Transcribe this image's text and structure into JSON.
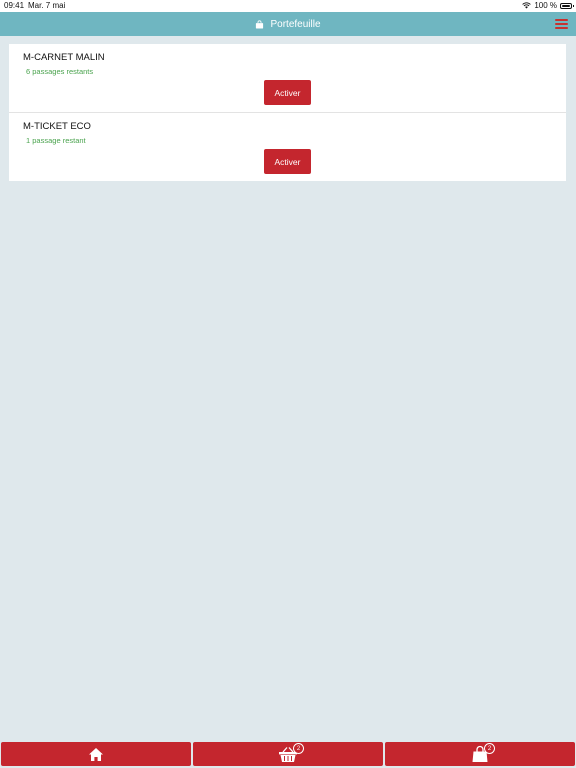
{
  "status_bar": {
    "time": "09:41",
    "date": "Mar. 7 mai",
    "battery": "100 %"
  },
  "header": {
    "title": "Portefeuille",
    "icon": "shopping-bag-icon",
    "menu_icon": "hamburger-menu-icon",
    "background": "#6fb6c1"
  },
  "tickets": [
    {
      "name": "M-CARNET MALIN",
      "remaining": "6 passages restants",
      "button": "Activer"
    },
    {
      "name": "M-TICKET ECO",
      "remaining": "1 passage restant",
      "button": "Activer"
    }
  ],
  "bottom_nav": {
    "home_icon": "home-icon",
    "basket_icon": "basket-icon",
    "basket_badge": "2",
    "bag_icon": "shopping-bag-icon",
    "bag_badge": "2"
  },
  "colors": {
    "accent": "#c4262e",
    "status_green": "#4aa34e",
    "page_bg": "#dfe8ec"
  }
}
